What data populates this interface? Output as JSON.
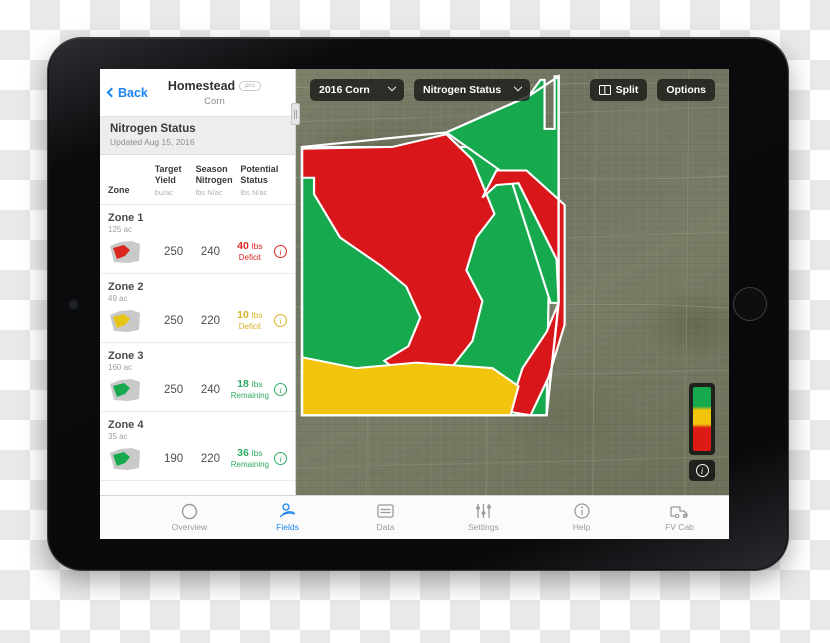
{
  "device": {
    "name": "tablet",
    "home_button": "home-button"
  },
  "sidebar": {
    "back_label": "Back",
    "field_name": "Homestead",
    "pro_badge": "pro",
    "crop": "Corn",
    "status_title": "Nitrogen Status",
    "status_updated": "Updated Aug 15, 2016",
    "columns": [
      {
        "label": "Zone",
        "unit": ""
      },
      {
        "label_l1": "Target",
        "label_l2": "Yield",
        "unit": "bu/ac"
      },
      {
        "label_l1": "Season",
        "label_l2": "Nitrogen",
        "unit": "lbs N/ac"
      },
      {
        "label_l1": "Potential",
        "label_l2": "Status",
        "unit": "lbs N/ac"
      }
    ],
    "zones": [
      {
        "name": "Zone 1",
        "acres": "125 ac",
        "target_yield": "250",
        "season_nitrogen": "240",
        "status_value": "40",
        "status_unit": "lbs",
        "status_label": "Deficit",
        "status_color": "#d9271f",
        "thumb_color": "#d9271f"
      },
      {
        "name": "Zone 2",
        "acres": "49 ac",
        "target_yield": "250",
        "season_nitrogen": "220",
        "status_value": "10",
        "status_unit": "lbs",
        "status_label": "Deficit",
        "status_color": "#d8b227",
        "thumb_color": "#e8c417"
      },
      {
        "name": "Zone 3",
        "acres": "160 ac",
        "target_yield": "250",
        "season_nitrogen": "240",
        "status_value": "18",
        "status_unit": "lbs",
        "status_label": "Remaining",
        "status_color": "#2faa62",
        "thumb_color": "#16a94e"
      },
      {
        "name": "Zone 4",
        "acres": "35 ac",
        "target_yield": "190",
        "season_nitrogen": "220",
        "status_value": "36",
        "status_unit": "lbs",
        "status_label": "Remaining",
        "status_color": "#2faa62",
        "thumb_color": "#16a94e"
      }
    ],
    "scroll_handle": "sidebar-scroll-handle"
  },
  "map": {
    "toolbar": {
      "season_select": "2016 Corn",
      "layer_select": "Nitrogen Status",
      "split_label": "Split",
      "options_label": "Options"
    },
    "legend": {
      "name": "nitrogen-legend",
      "high_color": "#16a94e",
      "mid_color": "#f2c40d",
      "low_color": "#dd1a16",
      "info_label": "i"
    },
    "zone_colors": {
      "green": "#16a94e",
      "yellow": "#f2c40d",
      "red": "#d9161a",
      "outline": "#ffffff"
    }
  },
  "tabbar": {
    "items": [
      {
        "label": "Overview",
        "icon": "circle-icon",
        "active": false
      },
      {
        "label": "Fields",
        "icon": "fields-icon",
        "active": true
      },
      {
        "label": "Data",
        "icon": "data-icon",
        "active": false
      },
      {
        "label": "Settings",
        "icon": "sliders-icon",
        "active": false
      },
      {
        "label": "Help",
        "icon": "info-icon",
        "active": false
      },
      {
        "label": "FV Cab",
        "icon": "truck-icon",
        "active": false
      }
    ]
  }
}
